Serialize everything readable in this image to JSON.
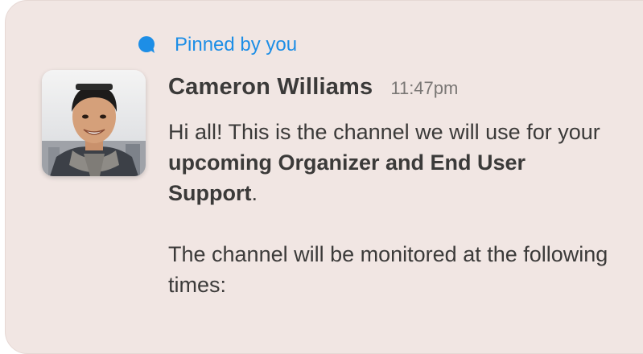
{
  "pinned": {
    "label": "Pinned by you",
    "icon": "pin-icon",
    "color": "#1d8ee6"
  },
  "message": {
    "author": "Cameron Williams",
    "timestamp": "11:47pm",
    "avatar_icon": "user-avatar",
    "paragraph1": {
      "prefix": "Hi all! This is the channel we will use for your ",
      "bold": "upcoming Organizer and End User Support",
      "suffix": "."
    },
    "paragraph2": "The channel will be monitored at the following times:"
  },
  "colors": {
    "card_background": "#f1e6e3",
    "text": "#3b3a39",
    "timestamp": "#7a7775"
  }
}
